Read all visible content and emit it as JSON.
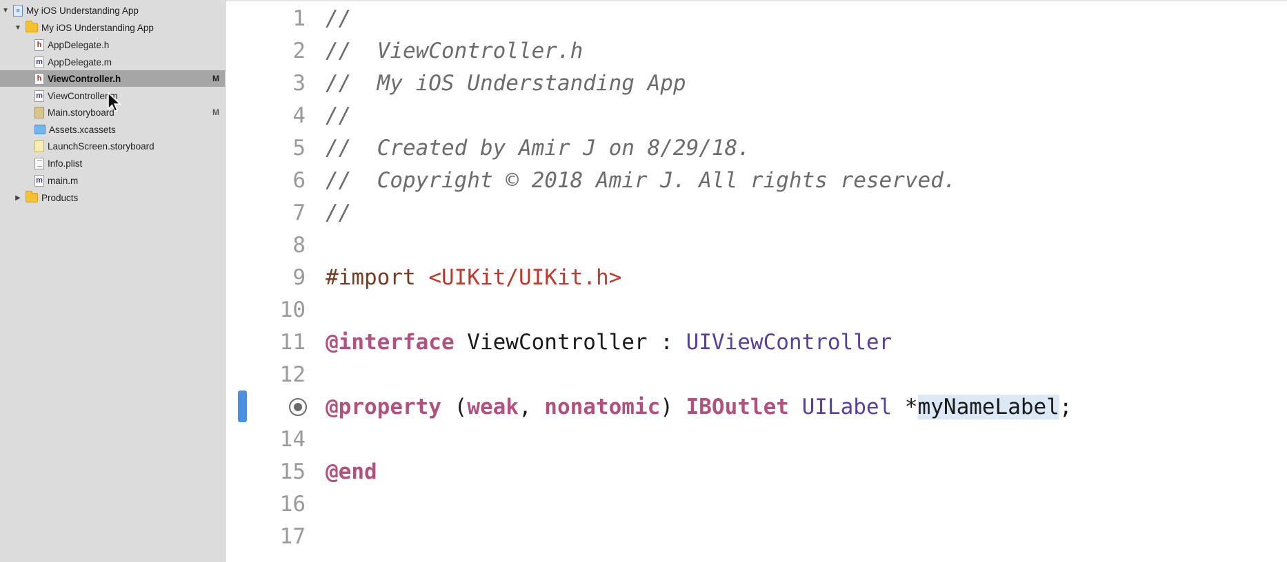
{
  "navigator": {
    "items": [
      {
        "label": "My iOS Understanding App",
        "icon": "project-icon",
        "indent": 0,
        "disclosure": "open",
        "badge": ""
      },
      {
        "label": "My iOS Understanding App",
        "icon": "folder-icon",
        "indent": 1,
        "disclosure": "open",
        "badge": ""
      },
      {
        "label": "AppDelegate.h",
        "icon": "header-file-icon",
        "indent": 2,
        "disclosure": "",
        "badge": ""
      },
      {
        "label": "AppDelegate.m",
        "icon": "implementation-file-icon",
        "indent": 2,
        "disclosure": "",
        "badge": ""
      },
      {
        "label": "ViewController.h",
        "icon": "header-file-icon",
        "indent": 2,
        "disclosure": "",
        "badge": "M",
        "selected": true
      },
      {
        "label": "ViewController.m",
        "icon": "implementation-file-icon",
        "indent": 2,
        "disclosure": "",
        "badge": ""
      },
      {
        "label": "Main.storyboard",
        "icon": "storyboard-icon",
        "indent": 2,
        "disclosure": "",
        "badge": "M"
      },
      {
        "label": "Assets.xcassets",
        "icon": "assets-icon",
        "indent": 2,
        "disclosure": "",
        "badge": ""
      },
      {
        "label": "LaunchScreen.storyboard",
        "icon": "storyboard-icon",
        "indent": 2,
        "disclosure": "",
        "badge": ""
      },
      {
        "label": "Info.plist",
        "icon": "plist-icon",
        "indent": 2,
        "disclosure": "",
        "badge": ""
      },
      {
        "label": "main.m",
        "icon": "implementation-file-icon",
        "indent": 2,
        "disclosure": "",
        "badge": ""
      },
      {
        "label": "Products",
        "icon": "folder-icon",
        "indent": 1,
        "disclosure": "closed",
        "badge": ""
      }
    ],
    "icon_glyphs": {
      "header": "h",
      "implementation": "m"
    }
  },
  "editor": {
    "lines": [
      {
        "num": "1",
        "tokens": [
          {
            "t": "//",
            "c": "comment"
          }
        ]
      },
      {
        "num": "2",
        "tokens": [
          {
            "t": "//  ViewController.h",
            "c": "comment"
          }
        ]
      },
      {
        "num": "3",
        "tokens": [
          {
            "t": "//  My iOS Understanding App",
            "c": "comment"
          }
        ]
      },
      {
        "num": "4",
        "tokens": [
          {
            "t": "//",
            "c": "comment"
          }
        ]
      },
      {
        "num": "5",
        "tokens": [
          {
            "t": "//  Created by Amir J on 8/29/18.",
            "c": "comment"
          }
        ]
      },
      {
        "num": "6",
        "tokens": [
          {
            "t": "//  Copyright © 2018 Amir J. All rights reserved.",
            "c": "comment"
          }
        ]
      },
      {
        "num": "7",
        "tokens": [
          {
            "t": "//",
            "c": "comment"
          }
        ]
      },
      {
        "num": "8",
        "tokens": []
      },
      {
        "num": "9",
        "tokens": [
          {
            "t": "#import ",
            "c": "preproc"
          },
          {
            "t": "<UIKit/UIKit.h>",
            "c": "string"
          }
        ]
      },
      {
        "num": "10",
        "tokens": []
      },
      {
        "num": "11",
        "tokens": [
          {
            "t": "@interface",
            "c": "keyword"
          },
          {
            "t": " ViewController : ",
            "c": "plain"
          },
          {
            "t": "UIViewController",
            "c": "type"
          }
        ]
      },
      {
        "num": "12",
        "tokens": []
      },
      {
        "num": "",
        "outlet": true,
        "tokens": [
          {
            "t": "@property",
            "c": "keyword"
          },
          {
            "t": " (",
            "c": "plain"
          },
          {
            "t": "weak",
            "c": "keyword"
          },
          {
            "t": ", ",
            "c": "plain"
          },
          {
            "t": "nonatomic",
            "c": "keyword"
          },
          {
            "t": ") ",
            "c": "plain"
          },
          {
            "t": "IBOutlet",
            "c": "keyword"
          },
          {
            "t": " ",
            "c": "plain"
          },
          {
            "t": "UILabel",
            "c": "type"
          },
          {
            "t": " *",
            "c": "plain"
          },
          {
            "t": "myNameLabel",
            "c": "selected"
          },
          {
            "t": ";",
            "c": "plain"
          }
        ]
      },
      {
        "num": "14",
        "tokens": []
      },
      {
        "num": "15",
        "tokens": [
          {
            "t": "@end",
            "c": "keyword"
          }
        ]
      },
      {
        "num": "16",
        "tokens": []
      },
      {
        "num": "17",
        "tokens": []
      }
    ]
  },
  "colors": {
    "comment": "#6c6c6c",
    "keyword": "#b2517f",
    "type": "#5a3ea0",
    "string": "#c0392b",
    "preproc": "#7a3a1d",
    "selection": "#dde8f7",
    "change_bar": "#4a90e2"
  }
}
